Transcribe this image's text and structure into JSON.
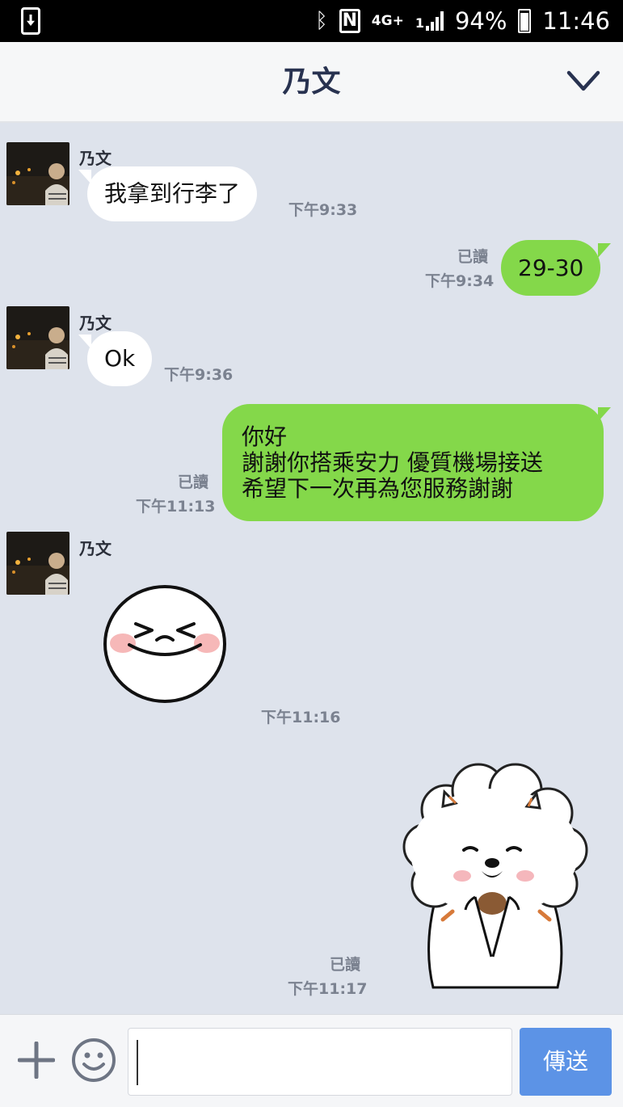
{
  "status_bar": {
    "battery": "94%",
    "time": "11:46",
    "network": "4G+",
    "signal_label": "1"
  },
  "header": {
    "title": "乃文"
  },
  "messages": [
    {
      "sender": "乃文",
      "text": "我拿到行李了",
      "time": "下午9:33"
    },
    {
      "text": "29-30",
      "read": "已讀",
      "time": "下午9:34"
    },
    {
      "sender": "乃文",
      "text": "Ok",
      "time": "下午9:36"
    },
    {
      "lines": [
        "你好",
        "謝謝你搭乘安力 優質機場接送",
        "希望下一次再為您服務謝謝"
      ],
      "read": "已讀",
      "time": "下午11:13"
    },
    {
      "sender": "乃文",
      "sticker": "laughing-face-sticker",
      "time": "下午11:16"
    },
    {
      "sticker": "sheep-sticker",
      "read": "已讀",
      "time": "下午11:17"
    }
  ],
  "input": {
    "placeholder": "",
    "send_label": "傳送"
  },
  "colors": {
    "outgoing_bubble": "#84d84a",
    "background": "#dee3ec",
    "send_button": "#5c93e6"
  }
}
